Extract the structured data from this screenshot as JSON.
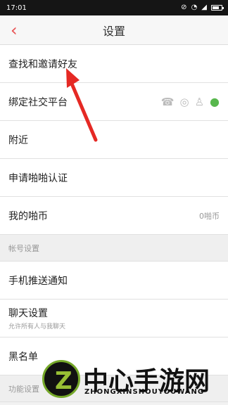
{
  "status": {
    "time": "17:01"
  },
  "header": {
    "title": "设置"
  },
  "menu": {
    "find_invite": "查找和邀请好友",
    "bind_social": "绑定社交平台",
    "nearby": "附近",
    "verify": "申请啪啪认证",
    "coins_label": "我的啪币",
    "coins_value": "0啪币"
  },
  "sections": {
    "account": "帐号设置",
    "function": "功能设置"
  },
  "account": {
    "push": "手机推送通知",
    "chat": "聊天设置",
    "chat_hint": "允许所有人与我聊天",
    "blacklist": "黑名单"
  },
  "watermark": {
    "title": "中心手游网",
    "subtitle": "ZHONGXINSHOUYOUWANG"
  },
  "colors": {
    "accent": "#e84f50",
    "wechat": "#58b74d"
  }
}
